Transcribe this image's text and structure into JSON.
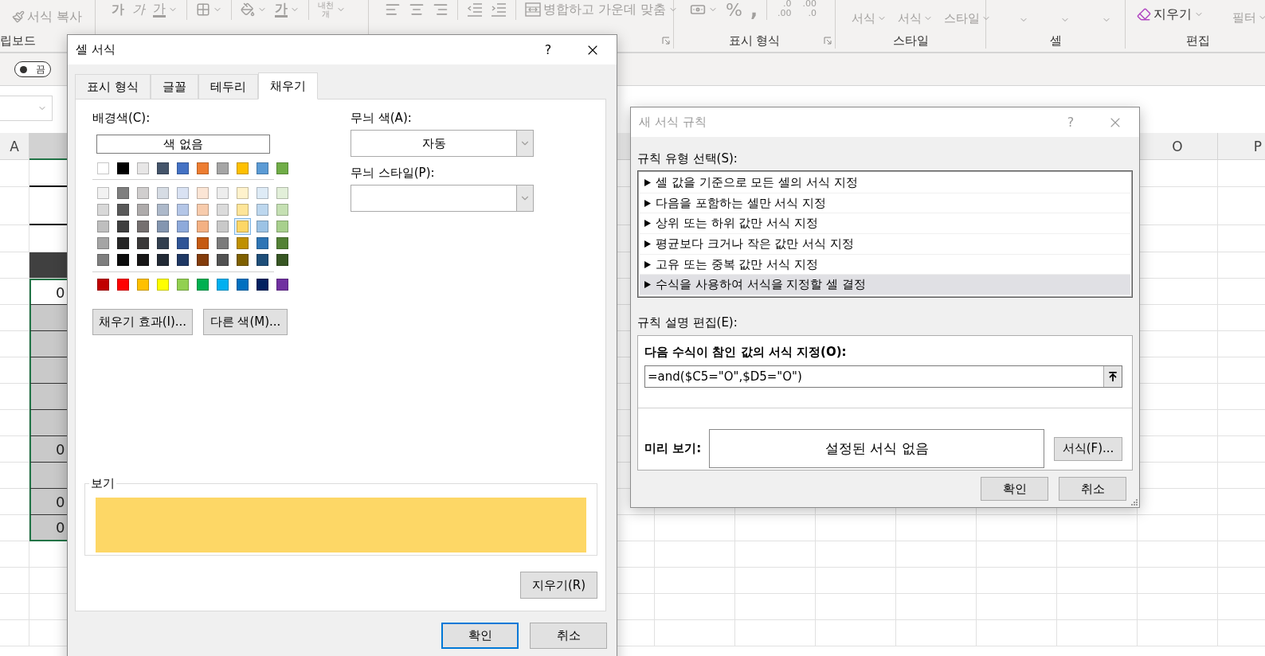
{
  "ribbon": {
    "clipboard": {
      "format_painter": "서식 복사",
      "label": "립보드"
    },
    "font": {
      "bold": "가",
      "italic": "가",
      "underline": "가",
      "font_color": "가",
      "wrap_lines": [
        "내천",
        "개"
      ]
    },
    "alignment": {
      "merge": "병합하고 가운데 맞춤"
    },
    "number": {
      "percent": "%",
      "comma": ",",
      "decimals": [
        {
          "top": ".0",
          "bottom": ".00"
        },
        {
          "top": ".00",
          "bottom": ".0"
        }
      ],
      "label": "표시 형식"
    },
    "styles": {
      "buttons": [
        "서식",
        "서식",
        "스타일"
      ],
      "label": "스타일"
    },
    "cells": {
      "label": "셀"
    },
    "editing": {
      "clear": "지우기",
      "sort": "필터",
      "label": "편집"
    }
  },
  "view_bar": {
    "toggle": {
      "label": "끔",
      "on": false
    }
  },
  "sheet": {
    "columns": [
      {
        "label": "A",
        "selected": false
      },
      {
        "selected": true
      },
      {
        "label": "O",
        "selected": false
      },
      {
        "label": "P",
        "selected": false
      }
    ],
    "rows": [
      {
        "kind": "ruled",
        "selected": false
      },
      {
        "kind": "ruled",
        "selected": false
      },
      {
        "kind": "blank",
        "selected": false
      },
      {
        "kind": "header",
        "selected": false
      },
      {
        "kind": "active",
        "text": "0",
        "selected": true
      },
      {
        "kind": "shaded",
        "selected": true
      },
      {
        "kind": "shaded",
        "selected": true
      },
      {
        "kind": "shaded",
        "selected": true
      },
      {
        "kind": "shaded",
        "selected": true
      },
      {
        "kind": "shaded",
        "selected": true
      },
      {
        "kind": "shaded",
        "text": "0",
        "selected": true
      },
      {
        "kind": "shaded",
        "selected": true
      },
      {
        "kind": "shaded",
        "text": "0",
        "selected": true
      },
      {
        "kind": "shaded",
        "text": "0",
        "selected": true
      }
    ]
  },
  "format_cells_dialog": {
    "title": "셀 서식",
    "help": "?",
    "tabs": [
      {
        "label": "표시 형식",
        "selected": false
      },
      {
        "label": "글꼴",
        "selected": false
      },
      {
        "label": "테두리",
        "selected": false
      },
      {
        "label": "채우기",
        "selected": true
      }
    ],
    "background_label": "배경색(C):",
    "no_color": "색 없음",
    "palette": [
      {
        "kind": "theme",
        "swatches": [
          {
            "color": "#ffffff",
            "selected": false
          },
          {
            "color": "#000000",
            "selected": false
          },
          {
            "color": "#e7e6e6",
            "selected": false
          },
          {
            "color": "#44546a",
            "selected": false
          },
          {
            "color": "#4472c4",
            "selected": false
          },
          {
            "color": "#ed7d31",
            "selected": false
          },
          {
            "color": "#a5a5a5",
            "selected": false
          },
          {
            "color": "#ffc000",
            "selected": false
          },
          {
            "color": "#5b9bd5",
            "selected": false
          },
          {
            "color": "#70ad47",
            "selected": false
          }
        ]
      },
      {
        "kind": "tint",
        "swatches": [
          {
            "color": "#f2f2f2",
            "selected": false
          },
          {
            "color": "#7f7f7f",
            "selected": false
          },
          {
            "color": "#d0cece",
            "selected": false
          },
          {
            "color": "#d6dce4",
            "selected": false
          },
          {
            "color": "#d9e2f3",
            "selected": false
          },
          {
            "color": "#fbe5d5",
            "selected": false
          },
          {
            "color": "#ededed",
            "selected": false
          },
          {
            "color": "#fff2cc",
            "selected": false
          },
          {
            "color": "#deebf6",
            "selected": false
          },
          {
            "color": "#e2efd9",
            "selected": false
          }
        ]
      },
      {
        "kind": "tint",
        "swatches": [
          {
            "color": "#d8d8d8",
            "selected": false
          },
          {
            "color": "#595959",
            "selected": false
          },
          {
            "color": "#aeabab",
            "selected": false
          },
          {
            "color": "#adb9ca",
            "selected": false
          },
          {
            "color": "#b4c6e7",
            "selected": false
          },
          {
            "color": "#f7cbac",
            "selected": false
          },
          {
            "color": "#dbdbdb",
            "selected": false
          },
          {
            "color": "#fee599",
            "selected": false
          },
          {
            "color": "#bdd7ee",
            "selected": false
          },
          {
            "color": "#c5e0b3",
            "selected": false
          }
        ]
      },
      {
        "kind": "tint",
        "swatches": [
          {
            "color": "#bfbfbf",
            "selected": false
          },
          {
            "color": "#3f3f3f",
            "selected": false
          },
          {
            "color": "#757070",
            "selected": false
          },
          {
            "color": "#8496b0",
            "selected": false
          },
          {
            "color": "#8eaadb",
            "selected": false
          },
          {
            "color": "#f4b183",
            "selected": false
          },
          {
            "color": "#c9c9c9",
            "selected": false
          },
          {
            "color": "#fdd766",
            "selected": true
          },
          {
            "color": "#9cc3e5",
            "selected": false
          },
          {
            "color": "#a8d08d",
            "selected": false
          }
        ]
      },
      {
        "kind": "tint",
        "swatches": [
          {
            "color": "#a5a5a5",
            "selected": false
          },
          {
            "color": "#262626",
            "selected": false
          },
          {
            "color": "#3a3838",
            "selected": false
          },
          {
            "color": "#323f4f",
            "selected": false
          },
          {
            "color": "#2f5496",
            "selected": false
          },
          {
            "color": "#c55a11",
            "selected": false
          },
          {
            "color": "#7b7b7b",
            "selected": false
          },
          {
            "color": "#bf9000",
            "selected": false
          },
          {
            "color": "#2e75b5",
            "selected": false
          },
          {
            "color": "#538135",
            "selected": false
          }
        ]
      },
      {
        "kind": "tint",
        "swatches": [
          {
            "color": "#7f7f7f",
            "selected": false
          },
          {
            "color": "#0c0c0c",
            "selected": false
          },
          {
            "color": "#171616",
            "selected": false
          },
          {
            "color": "#222a35",
            "selected": false
          },
          {
            "color": "#1f3864",
            "selected": false
          },
          {
            "color": "#833c0b",
            "selected": false
          },
          {
            "color": "#525252",
            "selected": false
          },
          {
            "color": "#7f6000",
            "selected": false
          },
          {
            "color": "#1e4e79",
            "selected": false
          },
          {
            "color": "#375623",
            "selected": false
          }
        ]
      },
      {
        "kind": "standard",
        "swatches": [
          {
            "color": "#c00000",
            "selected": false
          },
          {
            "color": "#ff0000",
            "selected": false
          },
          {
            "color": "#ffc000",
            "selected": false
          },
          {
            "color": "#ffff00",
            "selected": false
          },
          {
            "color": "#92d050",
            "selected": false
          },
          {
            "color": "#00b050",
            "selected": false
          },
          {
            "color": "#00b0f0",
            "selected": false
          },
          {
            "color": "#0070c0",
            "selected": false
          },
          {
            "color": "#002060",
            "selected": false
          },
          {
            "color": "#7030a0",
            "selected": false
          }
        ]
      }
    ],
    "fill_effects": "채우기 효과(I)...",
    "more_colors": "다른 색(M)...",
    "pattern_color_label": "무늬 색(A):",
    "pattern_color": "자동",
    "pattern_style_label": "무늬 스타일(P):",
    "preview_label": "보기",
    "clear": "지우기(R)",
    "ok": "확인",
    "cancel": "취소"
  },
  "new_rule_dialog": {
    "title": "새 서식 규칙",
    "help": "?",
    "active": false,
    "rule_type_label": "규칙 유형 선택(S):",
    "rule_types": [
      {
        "label": "셀 값을 기준으로 모든 셀의 서식 지정",
        "selected": false
      },
      {
        "label": "다음을 포함하는 셀만 서식 지정",
        "selected": false
      },
      {
        "label": "상위 또는 하위 값만 서식 지정",
        "selected": false
      },
      {
        "label": "평균보다 크거나 작은 값만 서식 지정",
        "selected": false
      },
      {
        "label": "고유 또는 중복 값만 서식 지정",
        "selected": false
      },
      {
        "label": "수식을 사용하여 서식을 지정할 셀 결정",
        "selected": true
      }
    ],
    "description_label": "규칙 설명 편집(E):",
    "formula_label": "다음 수식이 참인 값의 서식 지정(O):",
    "formula": "=and($C5=\"O\",$D5=\"O\")",
    "preview_label": "미리 보기:",
    "preview_text": "설정된 서식 없음",
    "format": "서식(F)...",
    "ok": "확인",
    "cancel": "취소"
  }
}
